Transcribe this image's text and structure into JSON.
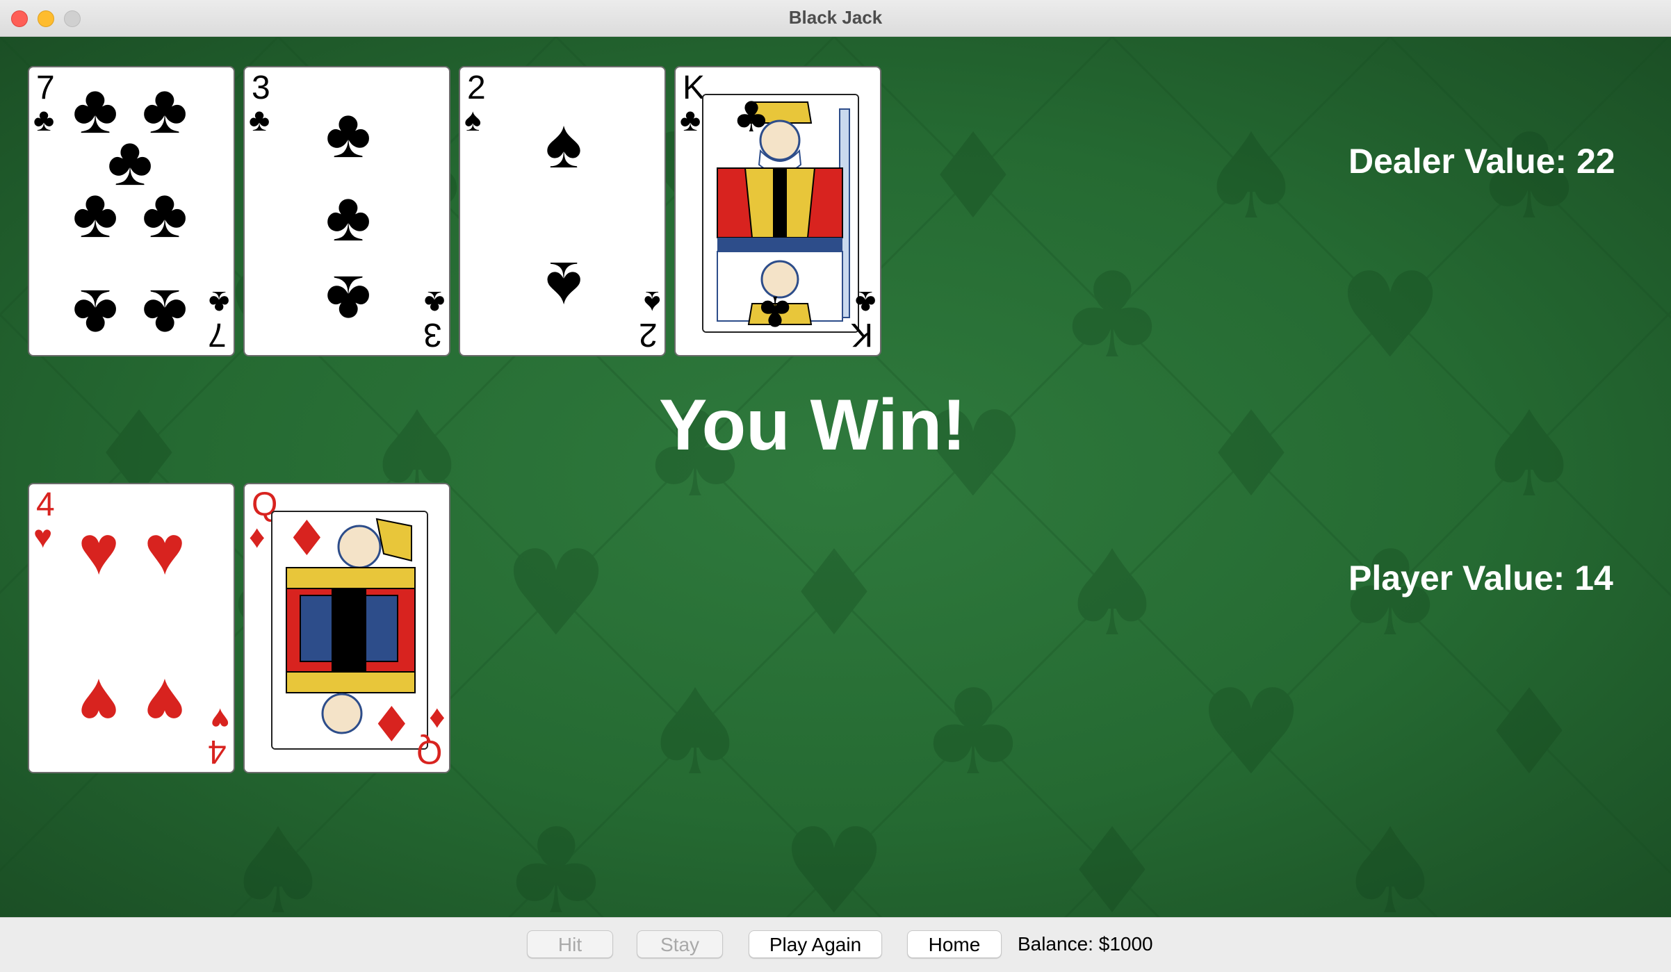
{
  "window": {
    "title": "Black Jack"
  },
  "dealer": {
    "label": "Dealer Value: 22",
    "cards": [
      {
        "rank": "7",
        "suit": "♣",
        "color": "black"
      },
      {
        "rank": "3",
        "suit": "♣",
        "color": "black"
      },
      {
        "rank": "2",
        "suit": "♠",
        "color": "black"
      },
      {
        "rank": "K",
        "suit": "♣",
        "color": "black"
      }
    ]
  },
  "player": {
    "label": "Player Value: 14",
    "cards": [
      {
        "rank": "4",
        "suit": "♥",
        "color": "red"
      },
      {
        "rank": "Q",
        "suit": "♦",
        "color": "red"
      }
    ]
  },
  "outcome": "You Win!",
  "controls": {
    "hit": "Hit",
    "stay": "Stay",
    "play_again": "Play Again",
    "home": "Home",
    "balance": "Balance: $1000"
  },
  "colors": {
    "table_green": "#256a32",
    "card_red": "#d8231f"
  }
}
